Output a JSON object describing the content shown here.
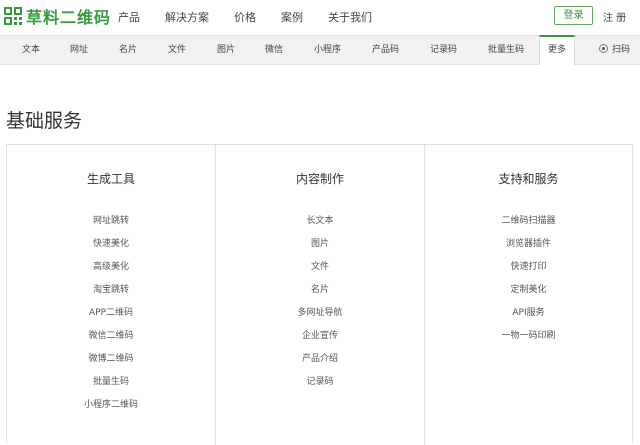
{
  "brand": {
    "name": "草料二维码",
    "accent_color": "#3a9b3e"
  },
  "main_nav": [
    "产品",
    "解决方案",
    "价格",
    "案例",
    "关于我们"
  ],
  "auth": {
    "login_label": "登录",
    "register_label": "注 册"
  },
  "sub_nav": {
    "items": [
      "文本",
      "网址",
      "名片",
      "文件",
      "图片",
      "微信",
      "小程序",
      "产品码",
      "记录码",
      "批量生码"
    ],
    "active_label": "更多",
    "scan_label": "扫码"
  },
  "page_title": "基础服务",
  "columns": [
    {
      "title": "生成工具",
      "links": [
        "网址跳转",
        "快速美化",
        "高级美化",
        "淘宝跳转",
        "APP二维码",
        "微信二维码",
        "微博二维码",
        "批量生码",
        "小程序二维码"
      ]
    },
    {
      "title": "内容制作",
      "links": [
        "长文本",
        "图片",
        "文件",
        "名片",
        "多网址导航",
        "企业宣传",
        "产品介绍",
        "记录码"
      ]
    },
    {
      "title": "支持和服务",
      "links": [
        "二维码扫描器",
        "浏览器插件",
        "快速打印",
        "定制美化",
        "API服务",
        "一物一码印刷"
      ]
    }
  ]
}
